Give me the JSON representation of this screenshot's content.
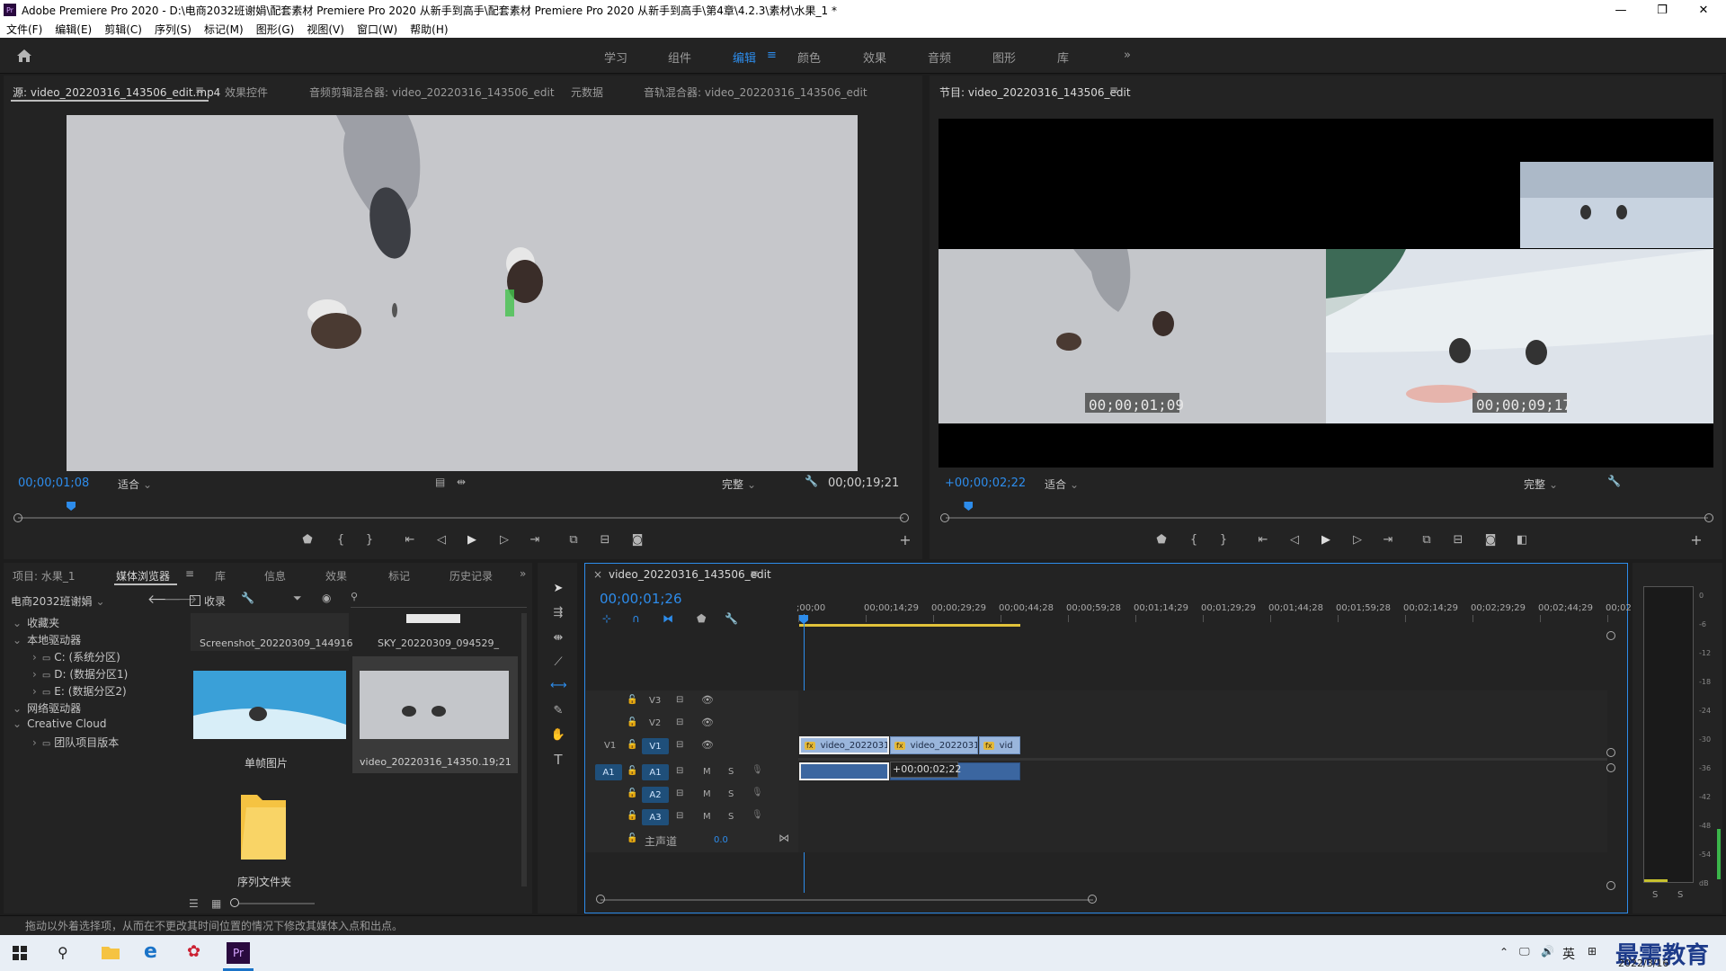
{
  "window": {
    "title": "Adobe Premiere Pro 2020 - D:\\电商2032班谢娟\\配套素材 Premiere Pro 2020 从新手到高手\\配套素材 Premiere Pro 2020 从新手到高手\\第4章\\4.2.3\\素材\\水果_1 *",
    "app_icon": "Pr",
    "controls": [
      "—",
      "❐",
      "✕"
    ]
  },
  "menu": [
    "文件(F)",
    "编辑(E)",
    "剪辑(C)",
    "序列(S)",
    "标记(M)",
    "图形(G)",
    "视图(V)",
    "窗口(W)",
    "帮助(H)"
  ],
  "workspaces": {
    "items": [
      "学习",
      "组件",
      "编辑",
      "颜色",
      "效果",
      "音频",
      "图形",
      "库"
    ],
    "active": "编辑",
    "more": "»"
  },
  "source_panel": {
    "tabs": [
      "源: video_20220316_143506_edit.mp4",
      "效果控件",
      "音频剪辑混合器: video_20220316_143506_edit",
      "元数据",
      "音轨混合器: video_20220316_143506_edit"
    ],
    "timecode": "00;00;01;08",
    "zoom": "适合",
    "quality": "完整",
    "duration": "00;00;19;21",
    "playhead_fraction": 0.06
  },
  "program_panel": {
    "title": "节目: video_20220316_143506_edit",
    "timecode": "+00;00;02;22",
    "zoom": "适合",
    "quality": "完整",
    "overlay_tc_left": "00;00;01;09",
    "overlay_tc_right": "00;00;09;17",
    "playhead_fraction": 0.03
  },
  "project_panel": {
    "tabs": [
      "项目: 水果_1",
      "媒体浏览器",
      "库",
      "信息",
      "效果",
      "标记",
      "历史记录"
    ],
    "active_tab": "媒体浏览器",
    "location": "电商2032班谢娟",
    "ingest_label": "收录",
    "tree": [
      {
        "label": "收藏夹",
        "level": 0
      },
      {
        "label": "本地驱动器",
        "level": 0
      },
      {
        "label": "C: (系统分区)",
        "level": 1
      },
      {
        "label": "D: (数据分区1)",
        "level": 1
      },
      {
        "label": "E: (数据分区2)",
        "level": 1
      },
      {
        "label": "网络驱动器",
        "level": 0
      },
      {
        "label": "Creative Cloud",
        "level": 0
      },
      {
        "label": "团队项目版本",
        "level": 1
      }
    ],
    "thumbs": [
      {
        "label": "Screenshot_20220309_144916"
      },
      {
        "label": "SKY_20220309_094529_"
      },
      {
        "label": "单帧图片"
      },
      {
        "label": "video_20220316_14350..",
        "duration": "19;21"
      },
      {
        "label": "序列文件夹"
      }
    ]
  },
  "timeline": {
    "sequence_tab": "video_20220316_143506_edit",
    "timecode": "00;00;01;26",
    "ruler": [
      ";00;00",
      "00;00;14;29",
      "00;00;29;29",
      "00;00;44;28",
      "00;00;59;28",
      "00;01;14;29",
      "00;01;29;29",
      "00;01;44;28",
      "00;01;59;28",
      "00;02;14;29",
      "00;02;29;29",
      "00;02;44;29",
      "00;02"
    ],
    "video_tracks": [
      "V3",
      "V2",
      "V1"
    ],
    "audio_tracks": [
      "A1",
      "A2",
      "A3"
    ],
    "source_patch_v": "V1",
    "source_patch_a": "A1",
    "master_label": "主声道",
    "master_value": "0.0",
    "mute": "M",
    "solo": "S",
    "clips": [
      {
        "label": "video_20220316",
        "fx": "fx"
      },
      {
        "label": "video_2022031",
        "fx": "fx"
      },
      {
        "label": "vid",
        "fx": "fx"
      }
    ],
    "drag_tooltip": "+00;00;02;22"
  },
  "meters": {
    "scale": [
      "0",
      "-6",
      "-12",
      "-18",
      "-24",
      "-30",
      "-36",
      "-42",
      "-48",
      "-54",
      "dB"
    ],
    "solo_left": "S",
    "solo_right": "S"
  },
  "status_bar": "拖动以外着选择项，从而在不更改其时间位置的情况下修改其媒体入点和出点。",
  "taskbar": {
    "lang": "英",
    "date": "2022/3/16",
    "watermark": "最需教育"
  }
}
